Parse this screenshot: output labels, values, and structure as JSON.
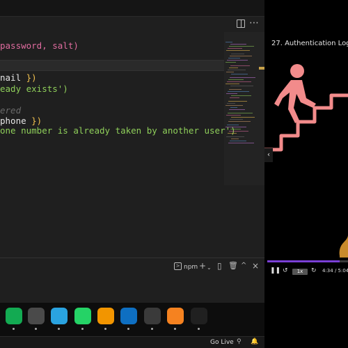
{
  "editor": {
    "code_lines": [
      {
        "segments": [
          {
            "t": "password, salt)",
            "c": "c-pink"
          }
        ]
      },
      {
        "segments": [
          {
            "t": "nail ",
            "c": "c-white"
          },
          {
            "t": "})",
            "c": "c-yellow"
          }
        ]
      },
      {
        "segments": [
          {
            "t": "eady exists')",
            "c": "c-green"
          }
        ]
      },
      {
        "segments": [
          {
            "t": "ered",
            "c": "c-comment"
          }
        ]
      },
      {
        "segments": [
          {
            "t": "phone ",
            "c": "c-white"
          },
          {
            "t": "})",
            "c": "c-yellow"
          }
        ]
      },
      {
        "segments": [
          {
            "t": "one number is already taken by another user')",
            "c": "c-green"
          }
        ]
      }
    ]
  },
  "panel": {
    "terminal_label": "npm",
    "icons": [
      "add-icon",
      "chevron-down-icon",
      "split-icon",
      "trash-icon",
      "chevron-up-icon",
      "close-icon"
    ]
  },
  "dock": {
    "apps": [
      {
        "name": "mongodb-icon",
        "color": "#13aa52"
      },
      {
        "name": "clock-icon",
        "color": "#4a4a4a"
      },
      {
        "name": "telegram-icon",
        "color": "#2aa3e0"
      },
      {
        "name": "whatsapp-icon",
        "color": "#25d366"
      },
      {
        "name": "sublime-icon",
        "color": "#f29500"
      },
      {
        "name": "vscode-icon",
        "color": "#0e6fc2"
      },
      {
        "name": "git-icon",
        "color": "#3a3a3a"
      },
      {
        "name": "vlc-icon",
        "color": "#f58220"
      },
      {
        "name": "terminal-icon",
        "color": "#202020"
      }
    ]
  },
  "statusbar": {
    "golive_label": "Go Live"
  },
  "video": {
    "title": "27. Authentication Log",
    "speed": "1x",
    "time": "4:34 / 5:04",
    "progress": 0.9,
    "figure_color": "#f28b8b",
    "progress_color": "#7a3fd6"
  }
}
